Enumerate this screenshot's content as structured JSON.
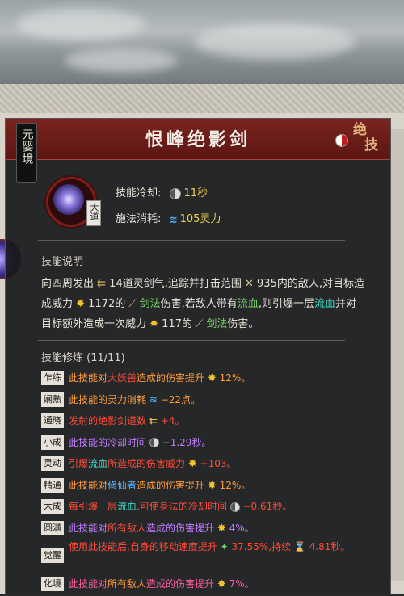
{
  "realm_tag": "元婴境",
  "skill": {
    "name": "恨峰绝影剑",
    "category_stamp": [
      "绝",
      "技"
    ],
    "rank_badge": "大道",
    "cooldown_label": "技能冷却:",
    "cooldown_value": "11秒",
    "cost_label": "施法消耗:",
    "cost_value": "105灵力"
  },
  "description": {
    "heading": "技能说明",
    "parts": [
      {
        "t": "向四周发出 ",
        "c": ""
      },
      {
        "t": "⇇",
        "c": "arrow"
      },
      {
        "t": " 14道灵剑气,追踪并打击范围 ",
        "c": ""
      },
      {
        "t": "✕",
        "c": "sword"
      },
      {
        "t": " 935内的敌人,对目标造成威力 ",
        "c": ""
      },
      {
        "t": "✸",
        "c": "sun"
      },
      {
        "t": " 1172的 ",
        "c": ""
      },
      {
        "t": "⟋",
        "c": "sword"
      },
      {
        "t": " 剑法",
        "c": "green"
      },
      {
        "t": "伤害,若敌人带有",
        "c": ""
      },
      {
        "t": "流血",
        "c": "green"
      },
      {
        "t": ",则引爆一层",
        "c": ""
      },
      {
        "t": "流血",
        "c": "teal"
      },
      {
        "t": "并对目标额外造成一次威力 ",
        "c": ""
      },
      {
        "t": "✸",
        "c": "sun"
      },
      {
        "t": " 117的 ",
        "c": ""
      },
      {
        "t": "⟋",
        "c": "sword"
      },
      {
        "t": " 剑法",
        "c": "green"
      },
      {
        "t": "伤害。",
        "c": ""
      }
    ]
  },
  "modifiers": {
    "heading": "技能修炼 (11/11)",
    "items": [
      {
        "tag": "乍练",
        "parts": [
          {
            "t": "此技能对",
            "c": "orange"
          },
          {
            "t": "大妖兽",
            "c": "red"
          },
          {
            "t": "造成的伤害提升 ",
            "c": "orange"
          },
          {
            "t": "✸",
            "c": "sun"
          },
          {
            "t": " 12%。",
            "c": "orange"
          }
        ]
      },
      {
        "tag": "娴熟",
        "parts": [
          {
            "t": "此技能的灵力消耗 ",
            "c": "orange"
          },
          {
            "t": "≋",
            "c": "blue"
          },
          {
            "t": " −22点。",
            "c": "orange"
          }
        ]
      },
      {
        "tag": "通晓",
        "parts": [
          {
            "t": "发射的绝影剑道数 ",
            "c": "red"
          },
          {
            "t": "⇇",
            "c": "arrow"
          },
          {
            "t": " +4。",
            "c": "red"
          }
        ]
      },
      {
        "tag": "小成",
        "parts": [
          {
            "t": "此技能的冷却时间 ",
            "c": "purple"
          },
          {
            "t": "◑",
            "c": "clock"
          },
          {
            "t": " −1.29秒。",
            "c": "purple"
          }
        ]
      },
      {
        "tag": "灵动",
        "parts": [
          {
            "t": "引爆",
            "c": "red"
          },
          {
            "t": "流血",
            "c": "teal"
          },
          {
            "t": "所造成的伤害威力 ",
            "c": "red"
          },
          {
            "t": "✸",
            "c": "sun"
          },
          {
            "t": " +103。",
            "c": "red"
          }
        ]
      },
      {
        "tag": "精通",
        "parts": [
          {
            "t": "此技能对",
            "c": "orange"
          },
          {
            "t": "修仙者",
            "c": "blue"
          },
          {
            "t": "造成的伤害提升 ",
            "c": "orange"
          },
          {
            "t": "✸",
            "c": "sun"
          },
          {
            "t": " 12%。",
            "c": "orange"
          }
        ]
      },
      {
        "tag": "大成",
        "parts": [
          {
            "t": "每引爆一层",
            "c": "red"
          },
          {
            "t": "流血",
            "c": "teal"
          },
          {
            "t": ",可使身法的冷却时间 ",
            "c": "red"
          },
          {
            "t": "◑",
            "c": "clock"
          },
          {
            "t": " −0.61秒。",
            "c": "red"
          }
        ]
      },
      {
        "tag": "圆满",
        "parts": [
          {
            "t": "此技能对",
            "c": "purple"
          },
          {
            "t": "所有敌人",
            "c": "red"
          },
          {
            "t": "造成的伤害提升 ",
            "c": "purple"
          },
          {
            "t": "✸",
            "c": "sun"
          },
          {
            "t": " 4%。",
            "c": "purple"
          }
        ]
      },
      {
        "tag": "觉醒",
        "two_line": true,
        "parts": [
          {
            "t": "使用此技能后,自身的移动速度提升 ",
            "c": "red"
          },
          {
            "t": "✦",
            "c": "green"
          },
          {
            "t": " 37.55%,持续 ",
            "c": "red"
          },
          {
            "t": "⌛",
            "c": "hourglass"
          },
          {
            "t": " 4.81秒。",
            "c": "red"
          }
        ]
      },
      {
        "tag": "化境",
        "parts": [
          {
            "t": "此技能对",
            "c": "pink"
          },
          {
            "t": "所有敌人",
            "c": "orange"
          },
          {
            "t": "造成的伤害提升 ",
            "c": "pink"
          },
          {
            "t": "✸",
            "c": "sun"
          },
          {
            "t": " 7%。",
            "c": "pink"
          }
        ]
      }
    ]
  },
  "colors": {
    "title_bar": "#6a1d1a",
    "panel_bg": "#181a1c",
    "sun_icon": "#f2c230",
    "mana_icon": "#62b9ff"
  }
}
